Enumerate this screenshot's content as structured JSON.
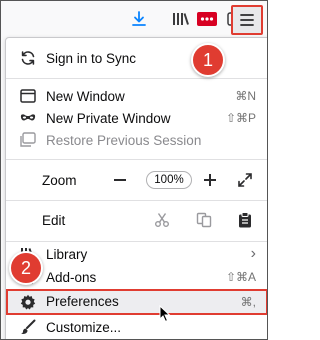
{
  "toolbar": {
    "icons": [
      "download-icon",
      "library-icon",
      "extension-icon",
      "sidebar-icon",
      "hamburger-menu-icon"
    ],
    "accent": "#0a84ff",
    "extension_color": "#d70022"
  },
  "menu": {
    "sign_in": "Sign in to Sync",
    "new_window": {
      "label": "New Window",
      "shortcut": "⌘N"
    },
    "new_private_window": {
      "label": "New Private Window",
      "shortcut": "⇧⌘P"
    },
    "restore_session": "Restore Previous Session",
    "zoom": {
      "label": "Zoom",
      "minus": "—",
      "value": "100%",
      "plus": "+"
    },
    "edit": {
      "label": "Edit"
    },
    "library": {
      "label": "Library",
      "arrow": "›"
    },
    "addons": {
      "label": "Add-ons",
      "shortcut": "⇧⌘A"
    },
    "preferences": {
      "label": "Preferences",
      "shortcut": "⌘,"
    },
    "customize": {
      "label": "Customize..."
    }
  },
  "callouts": {
    "step1": "1",
    "step2": "2",
    "color": "#e03c31"
  }
}
